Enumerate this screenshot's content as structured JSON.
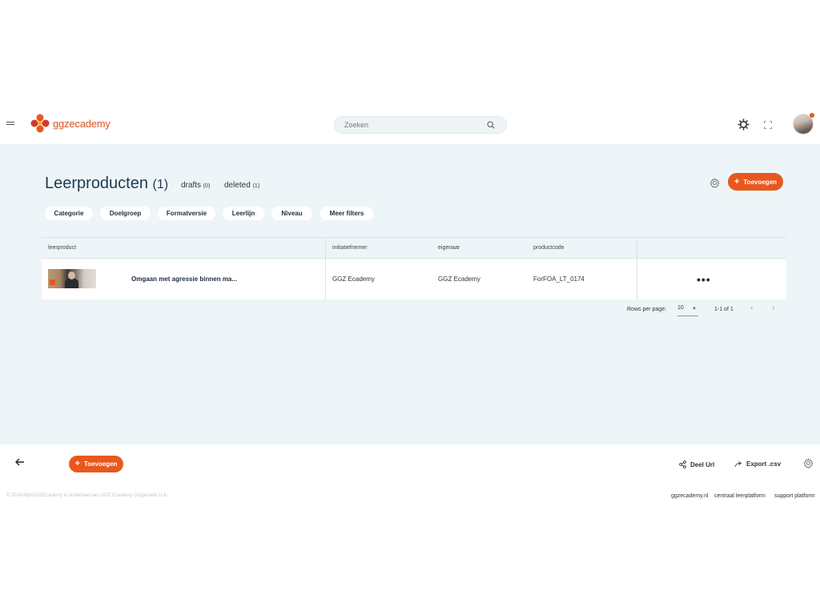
{
  "header": {
    "logo_prefix": "ggz",
    "logo_suffix": "ecademy",
    "search_placeholder": "Zoeken",
    "brand_color": "#e8581e"
  },
  "main": {
    "title": "Leerproducten",
    "title_count": "(1)",
    "tabs": [
      {
        "label": "drafts",
        "count": "(0)"
      },
      {
        "label": "deleted",
        "count": "(1)"
      }
    ],
    "add_label": "Toevoegen",
    "filters": [
      "Categorie",
      "Doelgroep",
      "Formatversie",
      "Leerlijn",
      "Niveau",
      "Meer filters"
    ]
  },
  "table": {
    "columns": [
      "leerproduct",
      "initiatiefnemer",
      "eigenaar",
      "productcode"
    ],
    "rows": [
      {
        "title": "Omgaan met agressie binnen ma...",
        "initiatiefnemer": "GGZ Ecademy",
        "eigenaar": "GGZ Ecademy",
        "productcode": "ForFOA_LT_0174",
        "menu": "•••"
      }
    ],
    "pagination": {
      "rows_per_page_label": "Rows per page:",
      "rows_per_page": "10",
      "range": "1-1 of 1"
    }
  },
  "footer": {
    "add_label": "Toevoegen",
    "share_label": "Deel Url",
    "export_label": "Export .csv",
    "copyright": "© 2024 MijnGGZEcademy is onderdeel van GGZ Ecademy Coöperatie U.A.",
    "links": [
      "ggzecademy.nl",
      "centraal leerplatform",
      "support platform"
    ]
  },
  "icons": [
    "hamburger-icon",
    "logo-flower-icon",
    "search-icon",
    "sun-gear-icon",
    "fullscreen-icon",
    "settings-gear-icon",
    "plus-icon",
    "chevron-down-icon",
    "chevron-left-icon",
    "chevron-right-icon",
    "arrow-left-icon",
    "share-icon",
    "export-arrow-icon"
  ]
}
